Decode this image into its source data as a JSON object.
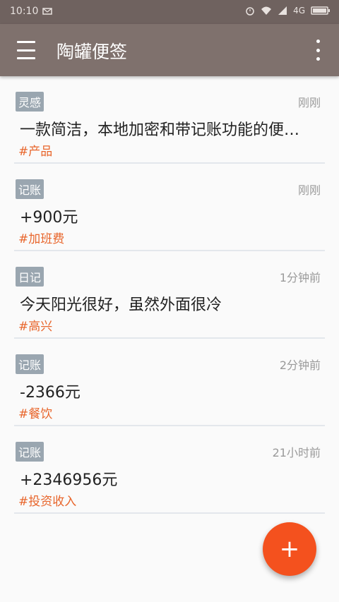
{
  "status_bar": {
    "time": "10:10",
    "network": "4G"
  },
  "app_bar": {
    "title": "陶罐便签"
  },
  "notes": [
    {
      "tag": "灵感",
      "time": "刚刚",
      "text": "一款简洁，本地加密和带记账功能的便…",
      "hashtag": "#产品"
    },
    {
      "tag": "记账",
      "time": "刚刚",
      "text": "+900元",
      "hashtag": "#加班费"
    },
    {
      "tag": "日记",
      "time": "1分钟前",
      "text": "今天阳光很好，虽然外面很冷",
      "hashtag": "#高兴"
    },
    {
      "tag": "记账",
      "time": "2分钟前",
      "text": "-2366元",
      "hashtag": "#餐饮"
    },
    {
      "tag": "记账",
      "time": "21小时前",
      "text": "+2346956元",
      "hashtag": "#投资收入"
    }
  ],
  "fab": {
    "label": "+"
  }
}
